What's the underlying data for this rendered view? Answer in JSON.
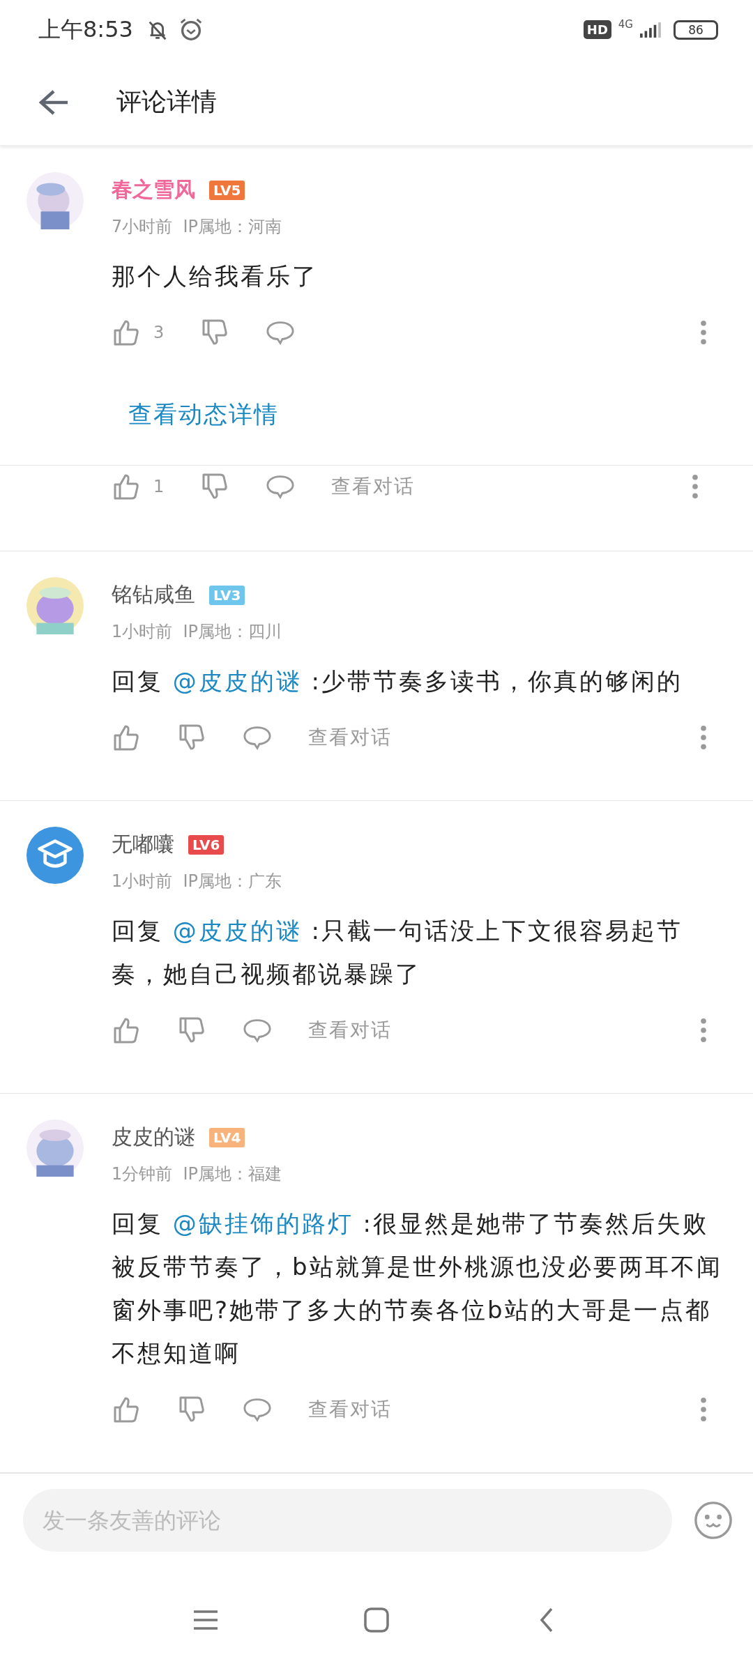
{
  "status_bar": {
    "time": "上午8:53",
    "hd": "HD",
    "network": "4G",
    "battery": "86"
  },
  "header": {
    "title": "评论详情"
  },
  "main_comment": {
    "name": "春之雪风",
    "vip": true,
    "level": "LV5",
    "color": "#f0773c",
    "meta": "7小时前  IP属地：河南",
    "text": "那个人给我看乐了",
    "likes": "3"
  },
  "dynamic_link": "查看动态详情",
  "partial_actions": {
    "likes": "1",
    "dialog": "查看对话"
  },
  "replies": [
    {
      "name": "铭钻咸鱼",
      "vip": false,
      "level": "LV3",
      "color": "#6ec6ec",
      "meta": "1小时前  IP属地：四川",
      "reply_prefix": "回复",
      "mention": "@皮皮的谜",
      "text": ":少带节奏多读书，你真的够闲的",
      "dialog": "查看对话"
    },
    {
      "name": "无嘟囔",
      "vip": false,
      "level": "LV6",
      "color": "#e84b4b",
      "avatar": {
        "kind": "default"
      },
      "meta": "1小时前  IP属地：广东",
      "reply_prefix": "回复",
      "mention": "@皮皮的谜",
      "text": ":只截一句话没上下文很容易起节奏，她自己视频都说暴躁了",
      "dialog": "查看对话"
    },
    {
      "name": "皮皮的谜",
      "vip": false,
      "level": "LV4",
      "color": "#f8b27c",
      "meta": "1分钟前  IP属地：福建",
      "reply_prefix": "回复",
      "mention": "@缺挂饰的路灯",
      "text": ":很显然是她带了节奏然后失败被反带节奏了，b站就算是世外桃源也没必要两耳不闻窗外事吧?她带了多大的节奏各位b站的大哥是一点都不想知道啊",
      "dialog": "查看对话"
    }
  ],
  "input": {
    "placeholder": "发一条友善的评论"
  }
}
